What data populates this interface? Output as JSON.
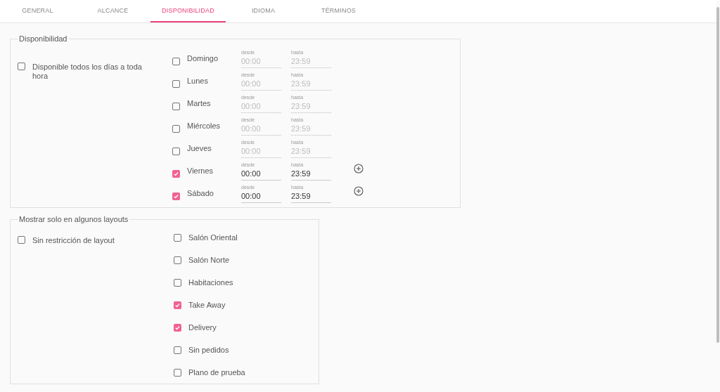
{
  "tabs": [
    {
      "label": "GENERAL",
      "selected": false
    },
    {
      "label": "ALCANCE",
      "selected": false
    },
    {
      "label": "DISPONIBILIDAD",
      "selected": true
    },
    {
      "label": "IDIOMA",
      "selected": false
    },
    {
      "label": "TÉRMINOS",
      "selected": false
    }
  ],
  "availability": {
    "legend": "Disponibilidad",
    "all_days": {
      "label": "Disponible todos los días a toda hora",
      "checked": false
    },
    "days": [
      {
        "label": "Domingo",
        "checked": false,
        "from_label": "desde",
        "from": "00:00",
        "to_label": "hasta",
        "to": "23:59"
      },
      {
        "label": "Lunes",
        "checked": false,
        "from_label": "desde",
        "from": "00:00",
        "to_label": "hasta",
        "to": "23:59"
      },
      {
        "label": "Martes",
        "checked": false,
        "from_label": "desde",
        "from": "00:00",
        "to_label": "hasta",
        "to": "23:59"
      },
      {
        "label": "Miércoles",
        "checked": false,
        "from_label": "desde",
        "from": "00:00",
        "to_label": "hasta",
        "to": "23:59"
      },
      {
        "label": "Jueves",
        "checked": false,
        "from_label": "desde",
        "from": "00:00",
        "to_label": "hasta",
        "to": "23:59"
      },
      {
        "label": "Viernes",
        "checked": true,
        "from_label": "desde",
        "from": "00:00",
        "to_label": "hasta",
        "to": "23:59"
      },
      {
        "label": "Sábado",
        "checked": true,
        "from_label": "desde",
        "from": "00:00",
        "to_label": "hasta",
        "to": "23:59"
      }
    ]
  },
  "layouts": {
    "legend": "Mostrar solo en algunos layouts",
    "no_restriction": {
      "label": "Sin restricción de layout",
      "checked": false
    },
    "items": [
      {
        "label": "Salón Oriental",
        "checked": false
      },
      {
        "label": "Salón Norte",
        "checked": false
      },
      {
        "label": "Habitaciones",
        "checked": false
      },
      {
        "label": "Take Away",
        "checked": true
      },
      {
        "label": "Delivery",
        "checked": true
      },
      {
        "label": "Sin pedidos",
        "checked": false
      },
      {
        "label": "Plano de prueba",
        "checked": false
      }
    ]
  }
}
